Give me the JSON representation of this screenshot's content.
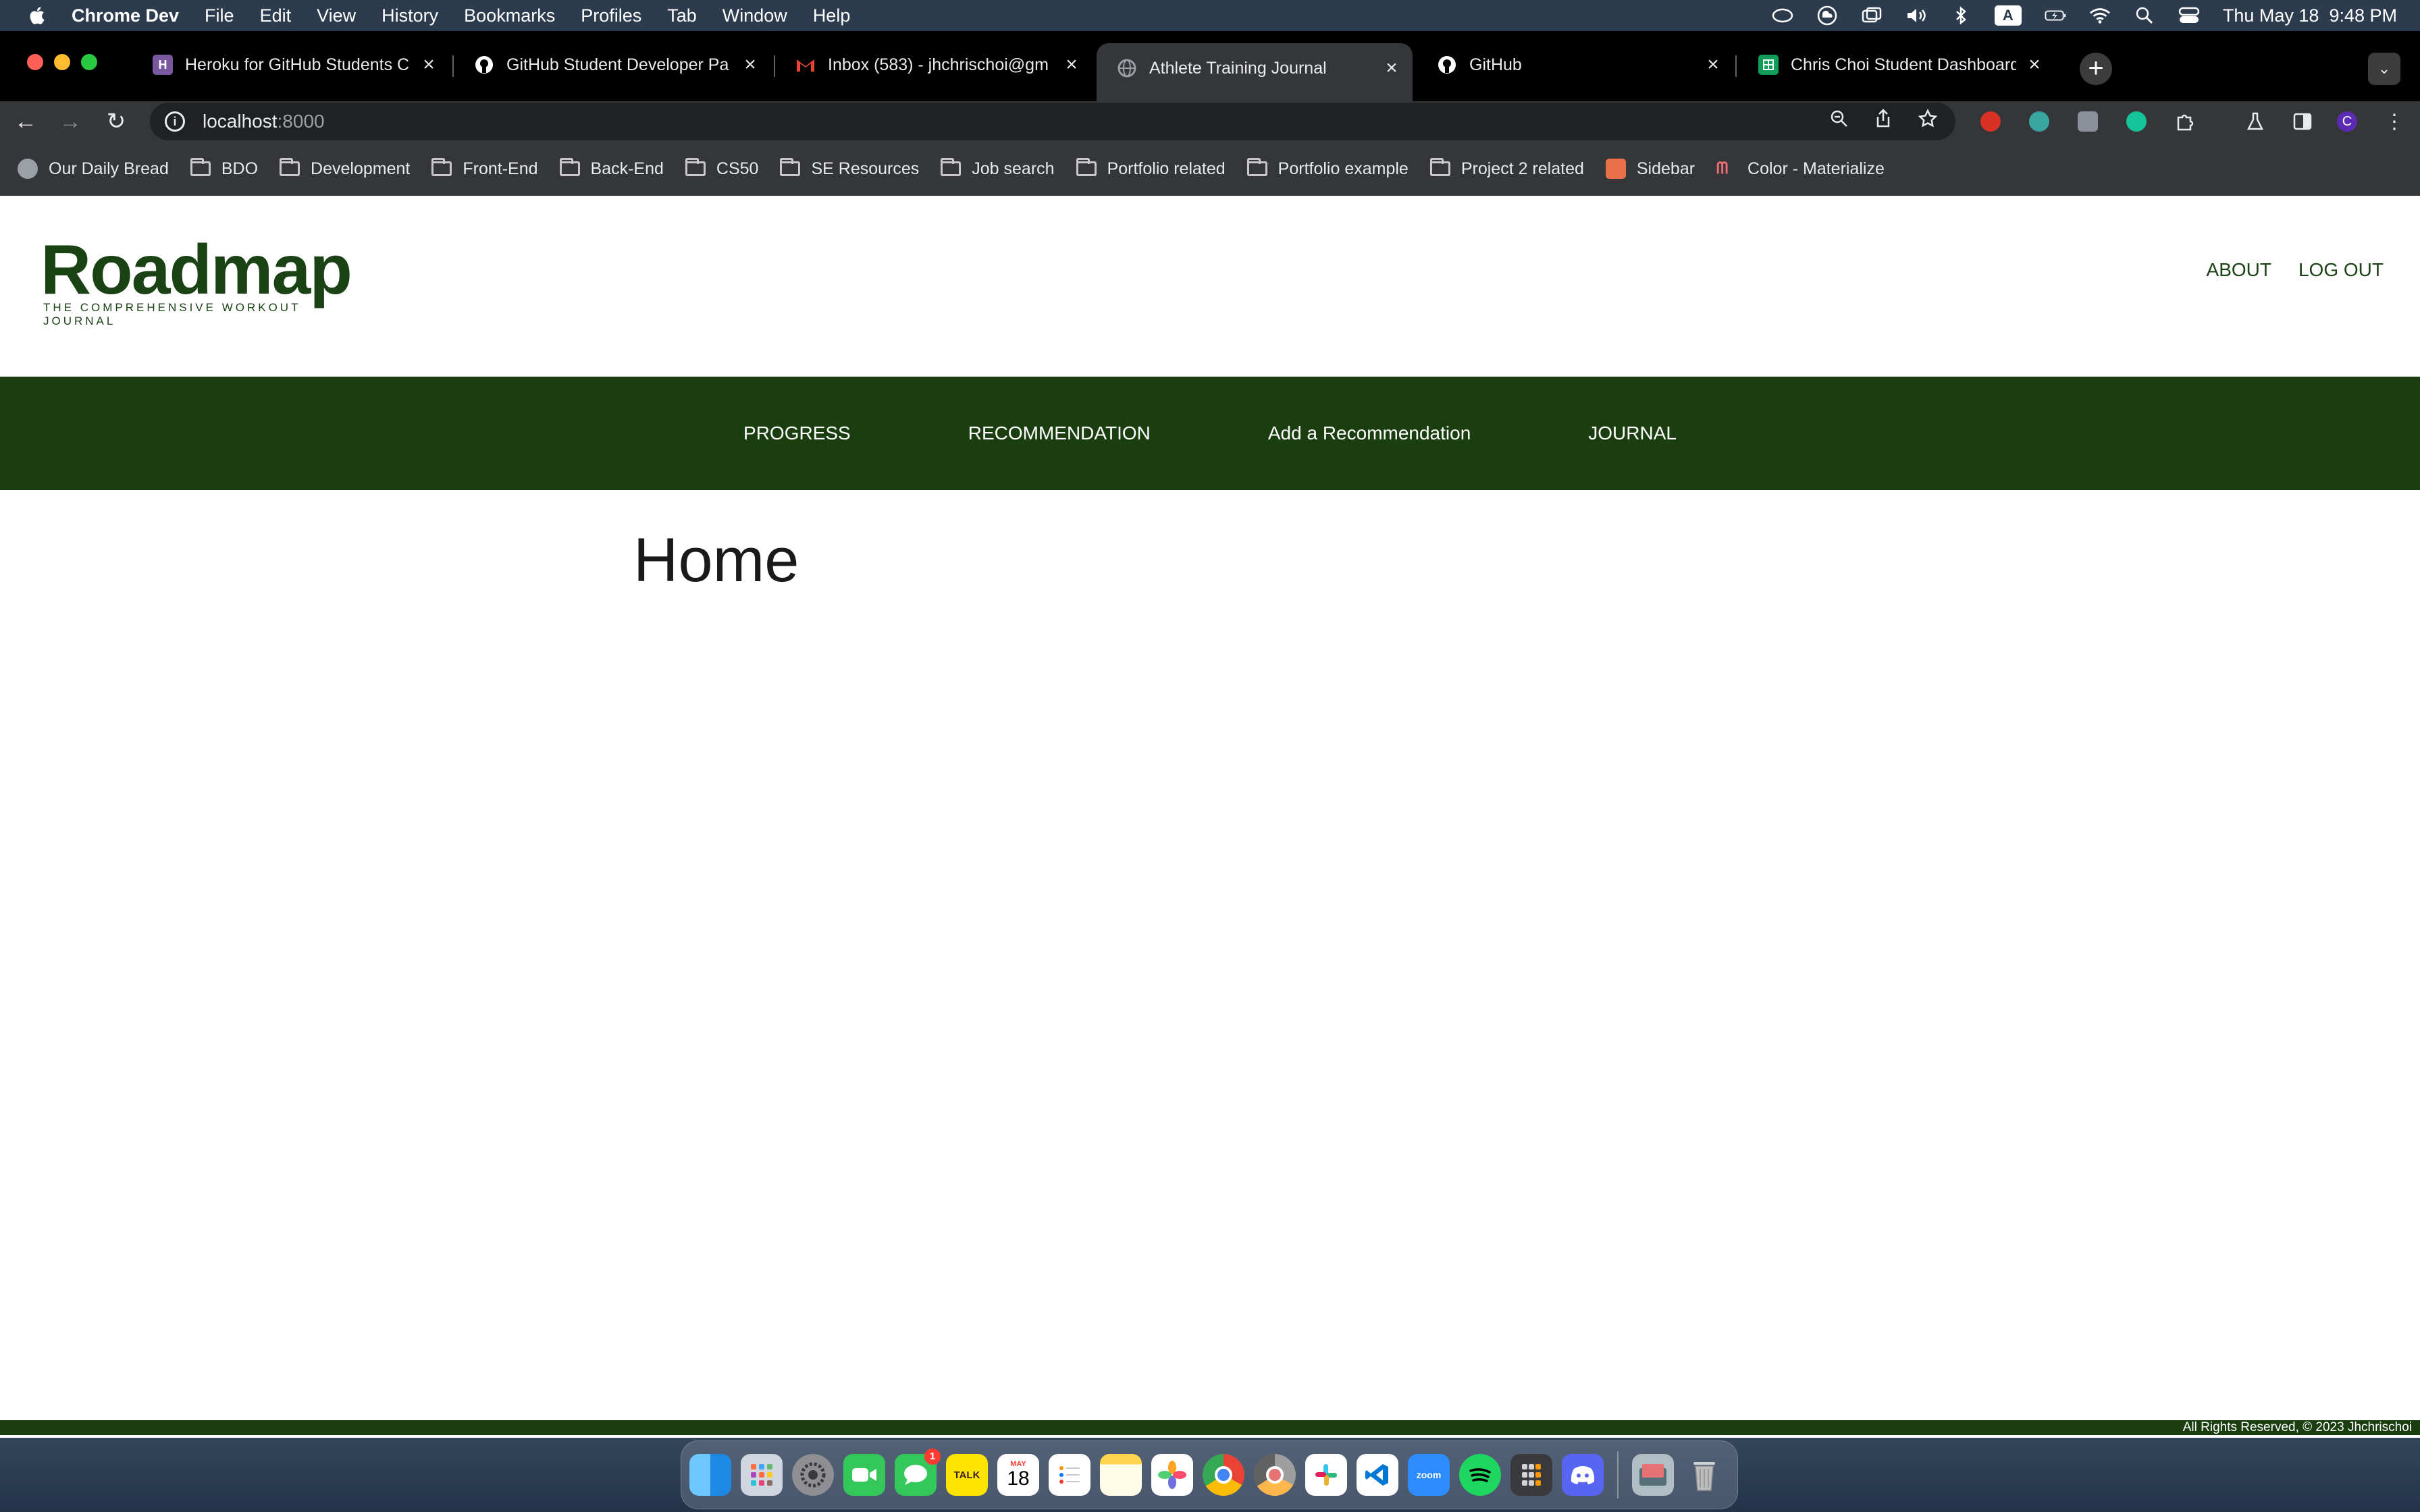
{
  "menubar": {
    "app_name": "Chrome Dev",
    "items": [
      "File",
      "Edit",
      "View",
      "History",
      "Bookmarks",
      "Profiles",
      "Tab",
      "Window",
      "Help"
    ],
    "clock": "Thu May 18  9:48 PM",
    "input_source": "A"
  },
  "tabs": [
    {
      "title": "Heroku for GitHub Students C",
      "favicon": "heroku-icon",
      "color": "#79589f"
    },
    {
      "title": "GitHub Student Developer Pa",
      "favicon": "github-icon",
      "color": "#ffffff"
    },
    {
      "title": "Inbox (583) - jhchrischoi@gm",
      "favicon": "gmail-icon",
      "color": "#ea4335"
    },
    {
      "title": "Athlete Training Journal",
      "favicon": "globe-icon",
      "color": "#9aa0a6",
      "active": true
    },
    {
      "title": "GitHub",
      "favicon": "github-icon",
      "color": "#ffffff"
    },
    {
      "title": "Chris Choi Student Dashboard",
      "favicon": "sheets-icon",
      "color": "#0f9d58"
    }
  ],
  "omnibox": {
    "host": "localhost",
    "port": ":8000"
  },
  "bookmarks": [
    {
      "label": "Our Daily Bread",
      "icon": "globe-icon"
    },
    {
      "label": "BDO",
      "icon": "folder-icon"
    },
    {
      "label": "Development",
      "icon": "folder-icon"
    },
    {
      "label": "Front-End",
      "icon": "folder-icon"
    },
    {
      "label": "Back-End",
      "icon": "folder-icon"
    },
    {
      "label": "CS50",
      "icon": "folder-icon"
    },
    {
      "label": "SE Resources",
      "icon": "folder-icon"
    },
    {
      "label": "Job search",
      "icon": "folder-icon"
    },
    {
      "label": "Portfolio related",
      "icon": "folder-icon"
    },
    {
      "label": "Portfolio example",
      "icon": "folder-icon"
    },
    {
      "label": "Project 2 related",
      "icon": "folder-icon"
    },
    {
      "label": "Sidebar",
      "icon": "sidebar-favicon"
    },
    {
      "label": "Color - Materialize",
      "icon": "materialize-favicon"
    }
  ],
  "site": {
    "logo_word": "Roadmap",
    "logo_tagline": "THE COMPREHENSIVE WORKOUT JOURNAL",
    "top_links": [
      "ABOUT",
      "LOG OUT"
    ],
    "nav": [
      "PROGRESS",
      "RECOMMENDATION",
      "Add a Recommendation",
      "JOURNAL"
    ],
    "page_title": "Home",
    "footer": "All Rights Reserved, © 2023 Jhchrischoi",
    "brand_color": "#1b3e10"
  },
  "profile_initial": "C",
  "dock": {
    "messages_badge": "1",
    "calendar_month": "MAY",
    "calendar_day": "18",
    "kakao_label": "TALK",
    "zoom_label": "zoom"
  }
}
